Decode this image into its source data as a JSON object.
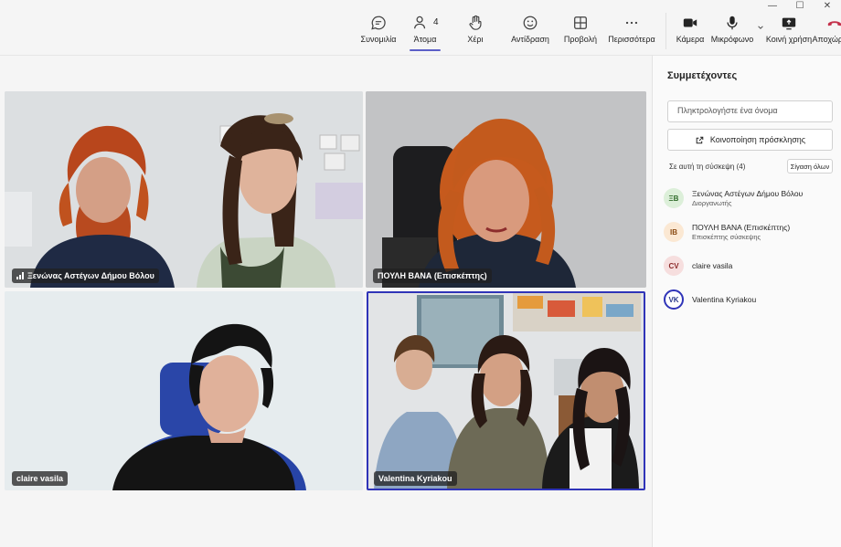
{
  "window": {
    "minimize": "—",
    "maximize": "☐",
    "close": "✕"
  },
  "toolbar": {
    "chat": "Συνομιλία",
    "people": "Άτομα",
    "people_count": "4",
    "hand": "Χέρι",
    "react": "Αντίδραση",
    "view": "Προβολή",
    "more": "Περισσότερα",
    "camera": "Κάμερα",
    "mic": "Μικρόφωνο",
    "share": "Κοινή χρήση",
    "leave": "Αποχώρηση"
  },
  "tiles": [
    {
      "name": "Ξενώνας Αστέγων Δήμου Βόλου"
    },
    {
      "name": "ΠΟΥΛΗ ΒΑΝΑ (Επισκέπτης)"
    },
    {
      "name": "claire vasila"
    },
    {
      "name": "Valentina Kyriakou"
    }
  ],
  "panel": {
    "title": "Συμμετέχοντες",
    "search_placeholder": "Πληκτρολογήστε ένα όνομα",
    "invite": "Κοινοποίηση πρόσκλησης",
    "section": "Σε αυτή τη σύσκεψη (4)",
    "mute_all": "Σίγαση όλων",
    "participants": [
      {
        "initials": "ΞΒ",
        "name": "Ξενώνας Αστέγων Δήμου Βόλου",
        "role": "Διοργανωτής",
        "bg": "#dcefd9",
        "fg": "#2f6b2a"
      },
      {
        "initials": "ΙΒ",
        "name": "ΠΟΥΛΗ ΒΑΝΑ (Επισκέπτης)",
        "role": "Επισκέπτης σύσκεψης",
        "bg": "#fbe8d3",
        "fg": "#8a4a12"
      },
      {
        "initials": "CV",
        "name": "claire vasila",
        "role": "",
        "bg": "#f6dede",
        "fg": "#8c2b2b"
      },
      {
        "initials": "VK",
        "name": "Valentina Kyriakou",
        "role": "",
        "bg": "#ffffff",
        "fg": "#2b3a8c"
      }
    ]
  },
  "colors": {
    "accent": "#5b5fc7",
    "leave": "#c4314b"
  }
}
